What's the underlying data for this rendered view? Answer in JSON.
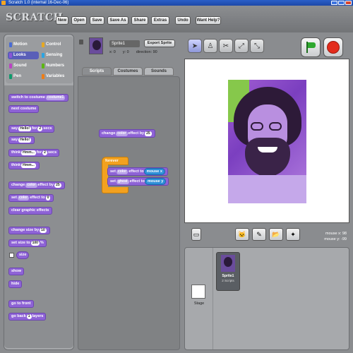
{
  "window": {
    "title": "Scratch 1.0 (internal 16-Dec-06)"
  },
  "app": {
    "logo": "SCRATCH"
  },
  "menu": [
    "New",
    "Open",
    "Save",
    "Save As",
    "Share",
    "Extras",
    "Undo",
    "Want Help?"
  ],
  "categories": [
    {
      "label": "Motion",
      "color": "#4a6cd4"
    },
    {
      "label": "Control",
      "color": "#e6a822"
    },
    {
      "label": "Looks",
      "color": "#8a55d7",
      "selected": true
    },
    {
      "label": "Sensing",
      "color": "#2ca5e2"
    },
    {
      "label": "Sound",
      "color": "#bb42c3"
    },
    {
      "label": "Numbers",
      "color": "#5cb712"
    },
    {
      "label": "Pen",
      "color": "#0e9a6c"
    },
    {
      "label": "Variables",
      "color": "#ee7d16"
    }
  ],
  "palette_blocks": {
    "switch_costume": "switch to costume",
    "switch_costume_val": "costume1",
    "next_costume": "next costume",
    "say_for": "say",
    "say_for_text": "Hello!",
    "say_for_mid": "for",
    "say_for_secs": "2",
    "say_for_end": "secs",
    "say": "say",
    "say_text": "Hello!",
    "think_for": "think",
    "think_for_text": "Hmm...",
    "think_for_mid": "for",
    "think_for_secs": "2",
    "think_for_end": "secs",
    "think": "think",
    "think_text": "Hmm...",
    "change_effect": "change",
    "change_effect_dd": "color",
    "change_effect_mid": "effect by",
    "change_effect_val": "25",
    "set_effect": "set",
    "set_effect_dd": "color",
    "set_effect_mid": "effect to",
    "set_effect_val": "0",
    "clear_effects": "clear graphic effects",
    "change_size": "change size by",
    "change_size_val": "10",
    "set_size": "set size to",
    "set_size_val": "100",
    "set_size_end": "%",
    "size": "size",
    "show": "show",
    "hide": "hide",
    "go_front": "go to front",
    "go_back": "go back",
    "go_back_val": "1",
    "go_back_end": "layers"
  },
  "sprite": {
    "name": "Sprite1",
    "export": "Export Sprite",
    "x": "x: 0",
    "y": "y: 0",
    "direction": "direction: 90"
  },
  "tabs": [
    "Scripts",
    "Costumes",
    "Sounds"
  ],
  "scripts": {
    "loose_change": "change",
    "loose_change_dd": "color",
    "loose_change_mid": "effect by",
    "loose_change_val": "25",
    "forever": "forever",
    "set1": "set",
    "set1_dd": "color",
    "set1_mid": "effect to",
    "set1_sense": "mouse x",
    "set2": "set",
    "set2_dd": "ghost",
    "set2_mid": "effect to",
    "set2_sense": "mouse y"
  },
  "stage_info": {
    "mouse_x": "mouse x: 98",
    "mouse_y": "mouse y: -99"
  },
  "sprites_panel": {
    "sprite_name": "Sprite1",
    "sprite_scripts": "2 Scripts",
    "stage_label": "Stage"
  }
}
